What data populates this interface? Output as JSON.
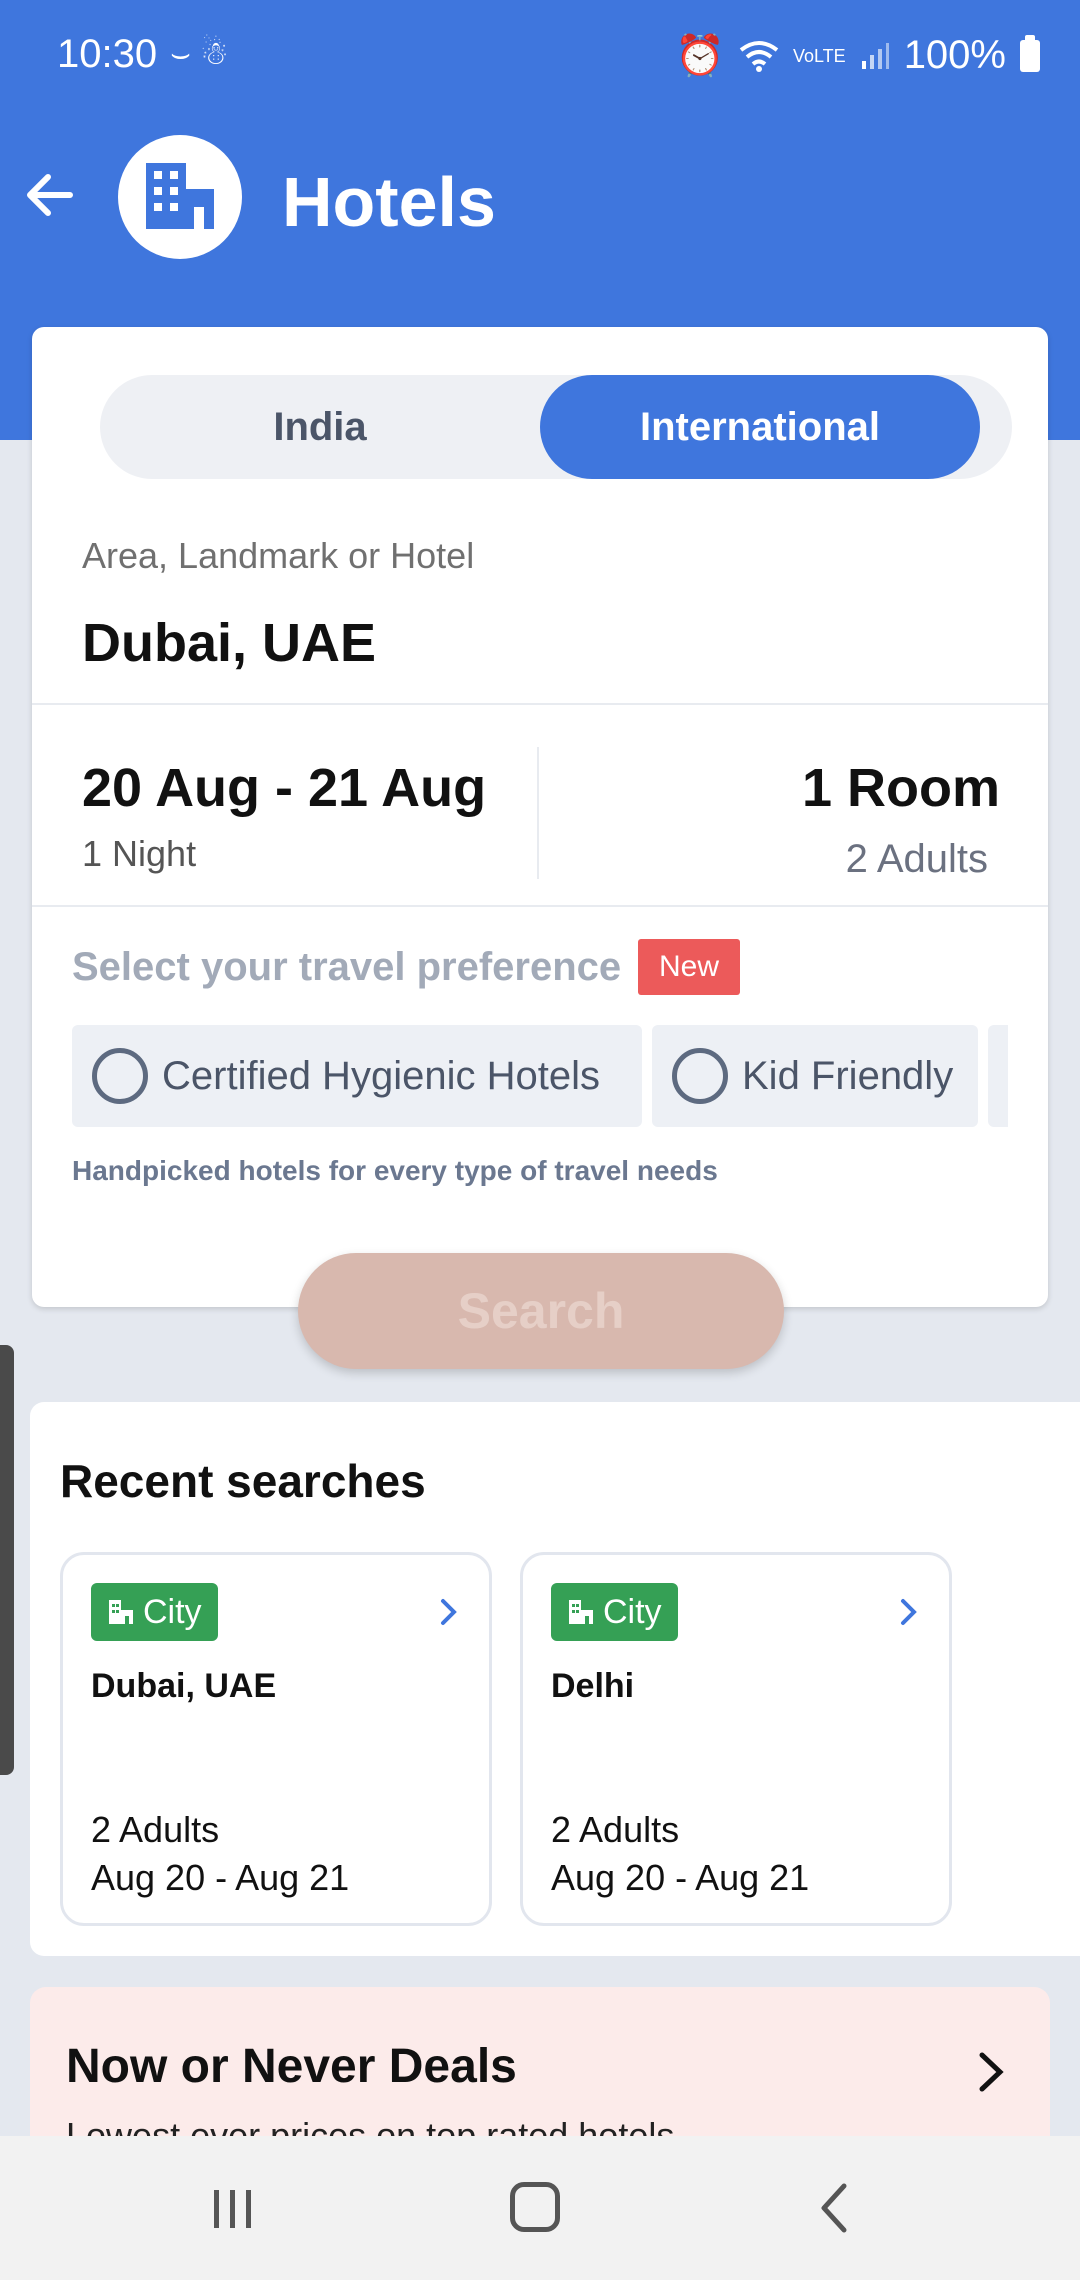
{
  "status_bar": {
    "time": "10:30",
    "battery": "100%"
  },
  "app_bar": {
    "title": "Hotels"
  },
  "search_form": {
    "tabs": [
      {
        "label": "India",
        "selected": false
      },
      {
        "label": "International",
        "selected": true
      }
    ],
    "location_label": "Area, Landmark or Hotel",
    "location_value": "Dubai, UAE",
    "dates": "20 Aug - 21 Aug",
    "nights": "1 Night",
    "rooms": "1 Room",
    "guests": "2 Adults",
    "preference_title": "Select your travel preference",
    "new_badge": "New",
    "preferences": [
      {
        "label": "Certified Hygienic Hotels",
        "checked": false
      },
      {
        "label": "Kid Friendly",
        "checked": false
      }
    ],
    "preference_subtitle": "Handpicked hotels for every type of travel needs",
    "search_button": "Search"
  },
  "recent_searches": {
    "title": "Recent searches",
    "items": [
      {
        "type": "City",
        "name": "Dubai, UAE",
        "guests": "2 Adults",
        "dates": "Aug 20 - Aug 21"
      },
      {
        "type": "City",
        "name": "Delhi",
        "guests": "2 Adults",
        "dates": "Aug 20 - Aug 21"
      }
    ]
  },
  "deals": {
    "title": "Now or Never Deals",
    "subtitle": "Lowest ever prices on top rated hotels"
  },
  "colors": {
    "primary": "#3f76dd",
    "new_badge": "#ec5a5a",
    "city_badge": "#35a055",
    "deals_bg": "#fcebea"
  }
}
